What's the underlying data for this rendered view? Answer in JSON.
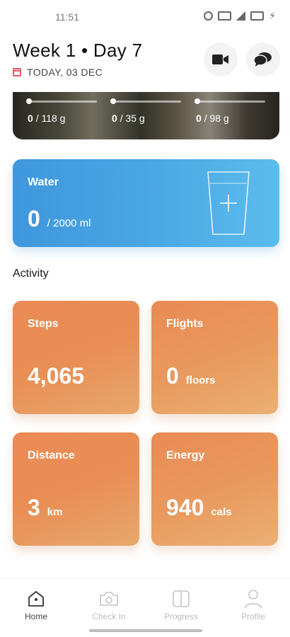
{
  "status_bar": {
    "time": "11:51"
  },
  "header": {
    "title": "Week 1 • Day 7",
    "date_label": "TODAY, 03 DEC",
    "icons": [
      "calendar-icon",
      "video-camera-icon",
      "chat-bubbles-icon"
    ]
  },
  "macros": [
    {
      "current": "0",
      "goal": "/ 118 g"
    },
    {
      "current": "0",
      "goal": "/ 35 g"
    },
    {
      "current": "0",
      "goal": "/ 98 g"
    }
  ],
  "water": {
    "title": "Water",
    "current": "0",
    "goal": "/ 2000 ml",
    "icon": "water-glass-add-icon"
  },
  "activity": {
    "title": "Activity",
    "cards": [
      {
        "label": "Steps",
        "value": "4,065",
        "unit": ""
      },
      {
        "label": "Flights",
        "value": "0",
        "unit": "floors"
      },
      {
        "label": "Distance",
        "value": "3",
        "unit": "km"
      },
      {
        "label": "Energy",
        "value": "940",
        "unit": "cals"
      }
    ]
  },
  "nav": [
    {
      "label": "Home",
      "icon": "home-icon",
      "active": true
    },
    {
      "label": "Check In",
      "icon": "camera-icon",
      "active": false
    },
    {
      "label": "Progress",
      "icon": "progress-icon",
      "active": false
    },
    {
      "label": "Profile",
      "icon": "profile-icon",
      "active": false
    }
  ],
  "colors": {
    "water_accent": "#4aa8e4",
    "activity_accent": "#e98e55",
    "calendar_accent": "#e35a68"
  }
}
